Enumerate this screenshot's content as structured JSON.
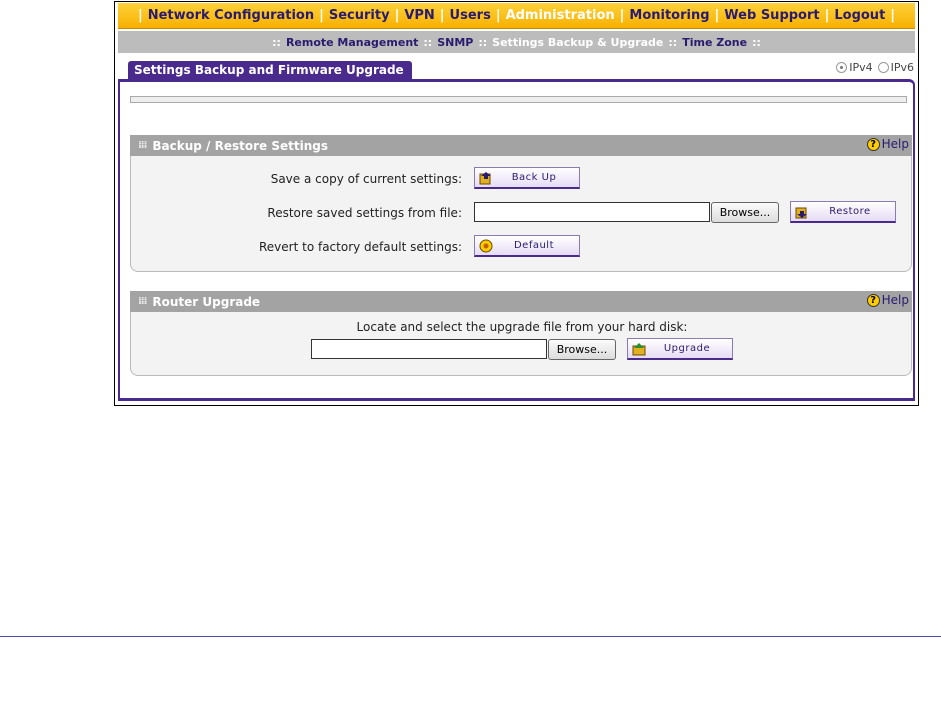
{
  "top_nav": {
    "items": [
      {
        "label": "Network Configuration",
        "active": false
      },
      {
        "label": "Security",
        "active": false
      },
      {
        "label": "VPN",
        "active": false
      },
      {
        "label": "Users",
        "active": false
      },
      {
        "label": "Administration",
        "active": true
      },
      {
        "label": "Monitoring",
        "active": false
      },
      {
        "label": "Web Support",
        "active": false
      },
      {
        "label": "Logout",
        "active": false
      }
    ],
    "separator": "|"
  },
  "sub_nav": {
    "items": [
      {
        "label": "Remote Management",
        "active": false
      },
      {
        "label": "SNMP",
        "active": false
      },
      {
        "label": "Settings Backup & Upgrade",
        "active": true
      },
      {
        "label": "Time Zone",
        "active": false
      }
    ],
    "separator": "::"
  },
  "page": {
    "tab_title": "Settings Backup and Firmware Upgrade",
    "ip_options": [
      {
        "label": "IPv4",
        "checked": true
      },
      {
        "label": "IPv6",
        "checked": false
      }
    ]
  },
  "backup_section": {
    "title": "Backup / Restore Settings",
    "help_label": "Help",
    "save_label": "Save a copy of current settings:",
    "backup_button": "Back Up",
    "restore_label": "Restore saved settings from file:",
    "restore_value": "",
    "browse_label": "Browse...",
    "restore_button": "Restore",
    "revert_label": "Revert to factory default settings:",
    "default_button": "Default"
  },
  "upgrade_section": {
    "title": "Router Upgrade",
    "help_label": "Help",
    "locate_label": "Locate and select the upgrade file from your hard disk:",
    "file_value": "",
    "browse_label": "Browse...",
    "upgrade_button": "Upgrade"
  },
  "colors": {
    "accent": "#4a2a8c",
    "nav_bg": "#f7b000",
    "section_header": "#a3a3a3"
  }
}
